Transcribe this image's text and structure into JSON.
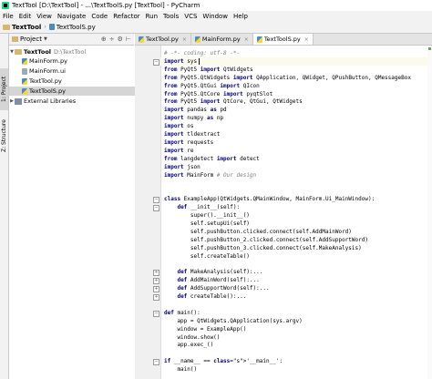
{
  "window": {
    "title": "TextTool [D:\\TextTool] - ...\\TextToolS.py [TextTool] - PyCharm"
  },
  "menu": [
    "File",
    "Edit",
    "View",
    "Navigate",
    "Code",
    "Refactor",
    "Run",
    "Tools",
    "VCS",
    "Window",
    "Help"
  ],
  "navbar": {
    "crumbs": [
      "TextTool",
      "TextToolS.py"
    ]
  },
  "left_tabs": {
    "project": "1: Project",
    "structure": "Z: Structure"
  },
  "project_panel": {
    "title": "Project",
    "root": {
      "name": "TextTool",
      "path": "D:\\TextTool"
    },
    "files": [
      "MainForm.py",
      "MainForm.ui",
      "TextTool.py",
      "TextToolS.py"
    ],
    "external": "External Libraries"
  },
  "tabs": [
    "TextTool.py",
    "MainForm.py",
    "TextToolS.py"
  ],
  "code_lines": [
    {
      "t": "# -*- coding: utf-8 -*-",
      "cls": "c"
    },
    {
      "t": "import sys",
      "kw": "import"
    },
    {
      "t": "from PyQt5 import QtWidgets"
    },
    {
      "t": "from PyQt5.QtWidgets import QApplication, QWidget, QPushButton, QMessageBox"
    },
    {
      "t": "from PyQt5.QtGui import QIcon"
    },
    {
      "t": "from PyQt5.QtCore import pyqtSlot"
    },
    {
      "t": "from PyQt5 import QtCore, QtGui, QtWidgets"
    },
    {
      "t": "import pandas as pd"
    },
    {
      "t": "import numpy as np"
    },
    {
      "t": "import os"
    },
    {
      "t": "import tldextract"
    },
    {
      "t": "import requests"
    },
    {
      "t": "import re"
    },
    {
      "t": "from langdetect import detect"
    },
    {
      "t": "import json"
    },
    {
      "t": "import MainForm # Our design"
    },
    {
      "t": ""
    },
    {
      "t": ""
    },
    {
      "t": "class ExampleApp(QtWidgets.QMainWindow, MainForm.Ui_MainWindow):"
    },
    {
      "t": "    def __init__(self):"
    },
    {
      "t": "        super().__init__()"
    },
    {
      "t": "        self.setupUi(self)"
    },
    {
      "t": "        self.pushButton.clicked.connect(self.AddMainWord)"
    },
    {
      "t": "        self.pushButton_2.clicked.connect(self.AddSupportWord)"
    },
    {
      "t": "        self.pushButton_3.clicked.connect(self.MakeAnalysis)"
    },
    {
      "t": "        self.createTable()"
    },
    {
      "t": ""
    },
    {
      "t": "    def MakeAnalysis(self):..."
    },
    {
      "t": "    def AddMainWord(self):..."
    },
    {
      "t": "    def AddSupportWord(self):..."
    },
    {
      "t": "    def createTable():..."
    },
    {
      "t": ""
    },
    {
      "t": "def main():"
    },
    {
      "t": "    app = QtWidgets.QApplication(sys.argv)"
    },
    {
      "t": "    window = ExampleApp()"
    },
    {
      "t": "    window.show()"
    },
    {
      "t": "    app.exec_()"
    },
    {
      "t": ""
    },
    {
      "t": "if __name__ == '__main__':"
    },
    {
      "t": "    main()"
    }
  ]
}
